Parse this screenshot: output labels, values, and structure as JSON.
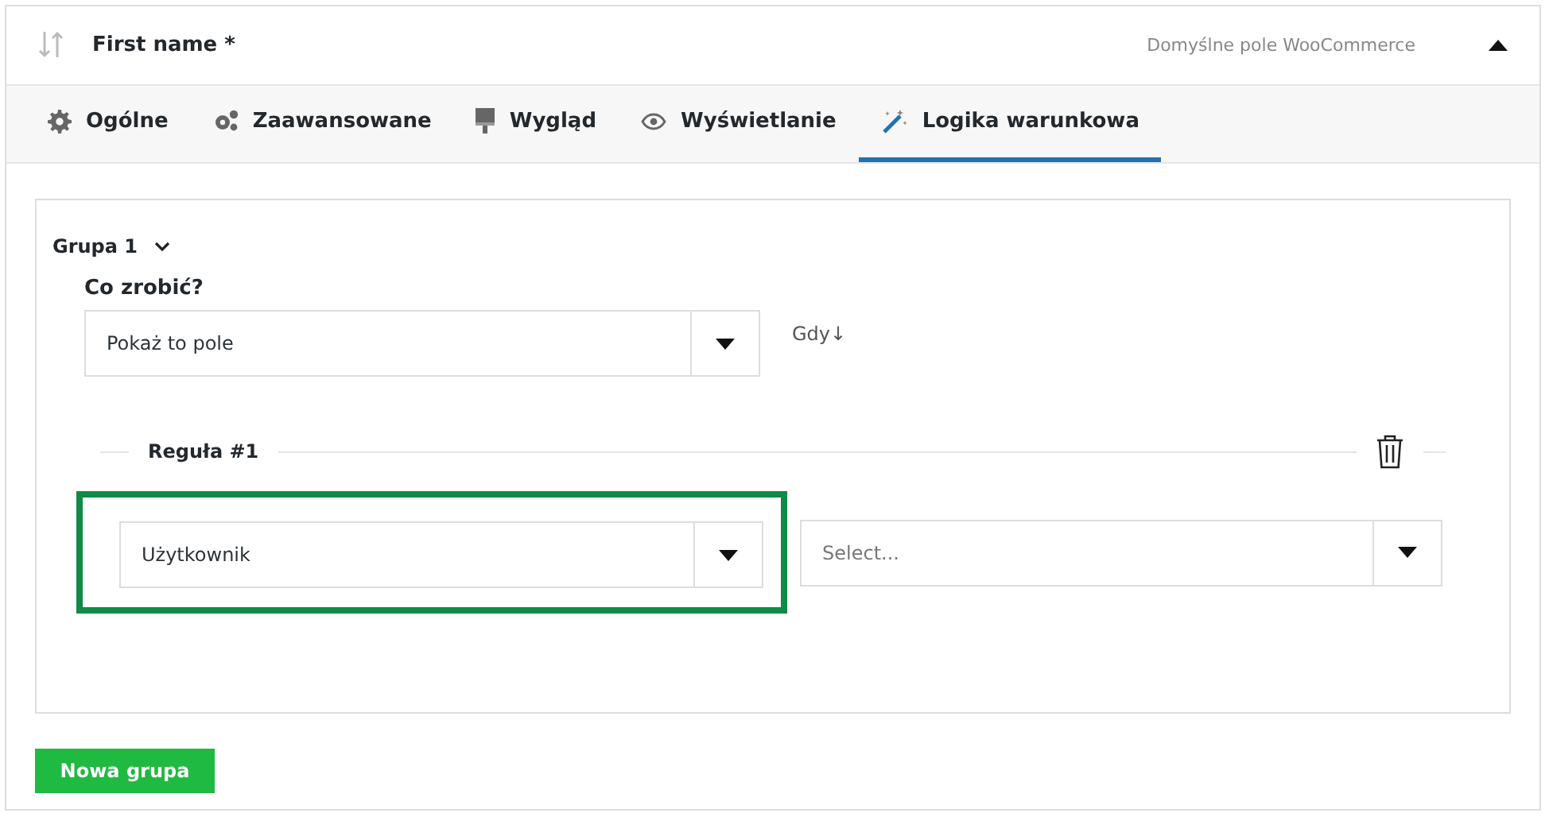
{
  "field_header": {
    "title": "First name *",
    "note": "Domyślne pole WooCommerce",
    "expanded": true
  },
  "tabs": [
    {
      "kind": "gear",
      "label": "Ogólne",
      "selected": false
    },
    {
      "kind": "gears",
      "label": "Zaawansowane",
      "selected": false
    },
    {
      "kind": "brush",
      "label": "Wygląd",
      "selected": false
    },
    {
      "kind": "eye",
      "label": "Wyświetlanie",
      "selected": false
    },
    {
      "kind": "wand",
      "label": "Logika warunkowa",
      "selected": true
    }
  ],
  "group": {
    "title": "Grupa 1",
    "expanded": true,
    "action_label": "Co zrobić?",
    "action_value": "Pokaż to pole",
    "when_label": "Gdy↓",
    "rule": {
      "title": "Reguła #1",
      "field_value": "Użytkownik",
      "field_highlighted": true,
      "condition_placeholder": "Select..."
    }
  },
  "new_group_button": "Nowa grupa"
}
